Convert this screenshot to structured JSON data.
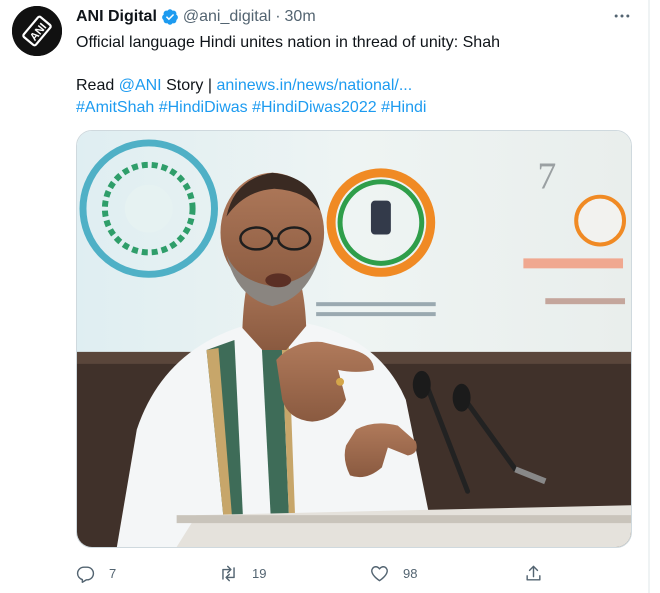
{
  "tweet": {
    "author": {
      "display_name": "ANI Digital",
      "handle": "@ani_digital",
      "avatar_text": "ANI",
      "verified": true
    },
    "separator": "·",
    "timestamp": "30m",
    "text": {
      "headline": "Official language Hindi unites nation in thread of unity: Shah",
      "read_prefix": "Read",
      "mention": "@ANI",
      "story_word": "Story |",
      "url": "aninews.in/news/national/...",
      "hashtags": [
        "#AmitShah",
        "#HindiDiwas",
        "#HindiDiwas2022",
        "#Hindi"
      ]
    },
    "media": {
      "description_icon": "photo-of-speaker-at-podium"
    },
    "actions": {
      "reply_count": "7",
      "retweet_count": "19",
      "like_count": "98"
    }
  },
  "colors": {
    "link": "#1d9bf0",
    "muted": "#536471",
    "text": "#0f1419",
    "verified": "#1d9bf0"
  }
}
